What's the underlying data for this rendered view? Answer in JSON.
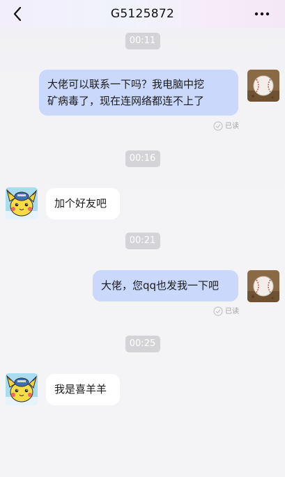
{
  "header": {
    "title": "G5125872",
    "back_icon": "chevron-left-icon",
    "more_icon": "more-horizontal-icon"
  },
  "messages": [
    {
      "type": "time",
      "text": "00:11"
    },
    {
      "type": "message",
      "direction": "outgoing",
      "lines": [
        "大佬可以联系一下吗？我电脑中挖",
        "矿病毒了，现在连网络都连不上了"
      ],
      "read_label": "已读",
      "avatar": "baseball-avatar"
    },
    {
      "type": "time",
      "text": "00:16"
    },
    {
      "type": "message",
      "direction": "incoming",
      "text": "加个好友吧",
      "avatar": "pikachu-avatar"
    },
    {
      "type": "time",
      "text": "00:21"
    },
    {
      "type": "message",
      "direction": "outgoing",
      "text": "大佬，您qq也发我一下吧",
      "read_label": "已读",
      "avatar": "baseball-avatar"
    },
    {
      "type": "time",
      "text": "00:25"
    },
    {
      "type": "message",
      "direction": "incoming",
      "text": "我是喜羊羊",
      "avatar": "pikachu-avatar"
    }
  ],
  "colors": {
    "outgoing_bubble": "#c9d8fb",
    "incoming_bubble": "#ffffff",
    "time_pill": "#d4d4d8"
  }
}
